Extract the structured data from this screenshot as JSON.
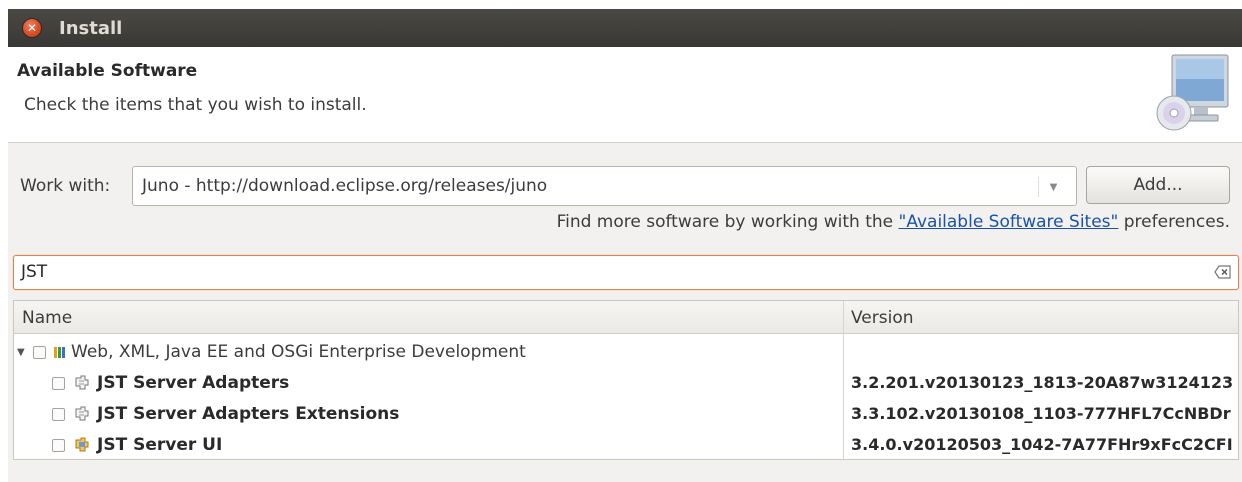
{
  "window": {
    "title": "Install"
  },
  "header": {
    "title": "Available Software",
    "subtitle": "Check the items that you wish to install."
  },
  "work_with": {
    "label": "Work with:",
    "value": "Juno - http://download.eclipse.org/releases/juno",
    "add_label": "Add..."
  },
  "more_software": {
    "prefix": "Find more software by working with the ",
    "link": "\"Available Software Sites\"",
    "suffix": " preferences."
  },
  "filter": {
    "value": "JST"
  },
  "table": {
    "columns": [
      "Name",
      "Version"
    ],
    "category": {
      "name": "Web, XML, Java EE and OSGi Enterprise Development",
      "expanded": true,
      "checked": false
    },
    "features": [
      {
        "name": "JST Server Adapters",
        "version": "3.2.201.v20130123_1813-20A87w3124123",
        "icon": "feature-icon",
        "checked": false
      },
      {
        "name": "JST Server Adapters Extensions",
        "version": "3.3.102.v20130108_1103-777HFL7CcNBDr",
        "icon": "feature-icon",
        "checked": false
      },
      {
        "name": "JST Server UI",
        "version": "3.4.0.v20120503_1042-7A77FHr9xFcC2CFI",
        "icon": "feature-ui-icon",
        "checked": false
      }
    ]
  },
  "colors": {
    "titlebar": "#3c3b37",
    "close": "#df4a21",
    "link": "#1a52a8",
    "filter_border": "#e0864d"
  }
}
